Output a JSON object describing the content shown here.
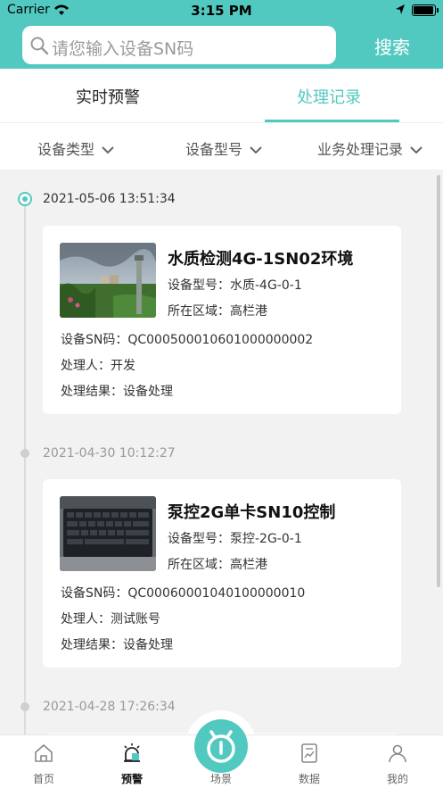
{
  "status_bar": {
    "carrier": "Carrier",
    "time": "3:15 PM"
  },
  "search": {
    "placeholder": "请您输入设备SN码",
    "button": "搜索"
  },
  "tabs": [
    {
      "label": "实时预警",
      "active": false
    },
    {
      "label": "处理记录",
      "active": true
    }
  ],
  "filters": [
    "设备类型",
    "设备型号",
    "业务处理记录"
  ],
  "records": [
    {
      "timestamp": "2021-05-06 13:51:34",
      "title": "水质检测4G-1SN02环境",
      "model": "设备型号：水质-4G-0-1",
      "area": "所在区域：高栏港",
      "sn": "设备SN码：QC000500010601000000002",
      "handler": "处理人：开发",
      "result": "处理结果：设备处理"
    },
    {
      "timestamp": "2021-04-30 10:12:27",
      "title": "泵控2G单卡SN10控制",
      "model": "设备型号：泵控-2G-0-1",
      "area": "所在区域：高栏港",
      "sn": "设备SN码：QC00060001040100000010",
      "handler": "处理人：测试账号",
      "result": "处理结果：设备处理"
    },
    {
      "timestamp": "2021-04-28 17:26:34"
    }
  ],
  "bottom_nav": [
    {
      "label": "首页",
      "icon": "home-icon"
    },
    {
      "label": "预警",
      "icon": "alarm-icon",
      "active": true
    },
    {
      "label": "场景",
      "icon": "scene-icon"
    },
    {
      "label": "数据",
      "icon": "data-icon"
    },
    {
      "label": "我的",
      "icon": "user-icon"
    }
  ],
  "colors": {
    "accent": "#52c9c0"
  }
}
